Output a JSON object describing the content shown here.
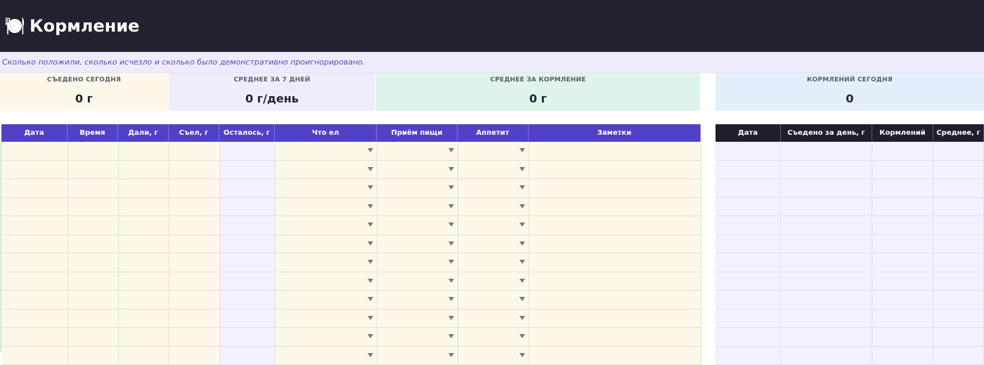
{
  "header": {
    "icon": "plate-with-cutlery-icon",
    "title": "Кормление"
  },
  "subtitle": "Сколько положили, сколько исчезло и сколько было демонстративно проигнорировано.",
  "stats": [
    {
      "label": "СЪЕДЕНО СЕГОДНЯ",
      "value": "0 г",
      "color": "#fdf8e9"
    },
    {
      "label": "СРЕДНЕЕ ЗА 7 ДНЕЙ",
      "value": "0 г/день",
      "color": "#efedfc"
    },
    {
      "label": "СРЕДНЕЕ ЗА КОРМЛЕНИЕ",
      "value": "0 г",
      "color": "#dff4ea"
    },
    {
      "label": "КОРМЛЕНИЙ СЕГОДНЯ",
      "value": "0",
      "color": "#e3f0fb"
    }
  ],
  "feed_table": {
    "columns": [
      "Дата",
      "Время",
      "Дали, г",
      "Съел, г",
      "Осталось, г",
      "Что ел",
      "Приём пищи",
      "Аппетит",
      "Заметки"
    ],
    "dropdown_columns": [
      5,
      6,
      7
    ],
    "row_count": 12
  },
  "daily_table": {
    "columns": [
      "Дата",
      "Съедено за день, г",
      "Кормлений",
      "Среднее, г"
    ],
    "row_count": 12
  },
  "colors": {
    "header_bg": "#24212f",
    "accent": "#5042c7",
    "input_cell": "#fdf8e9",
    "calc_cell": "#f3f1fd",
    "table_border": "#9bdaa4"
  }
}
